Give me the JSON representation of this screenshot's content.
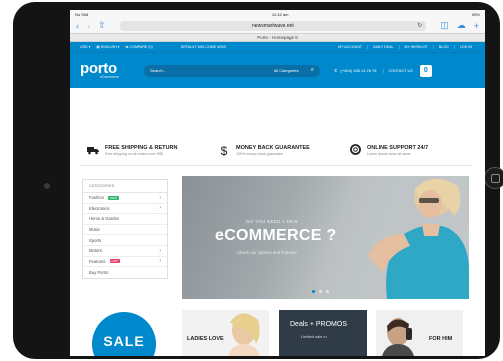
{
  "status_bar": {
    "carrier": "No SIM",
    "time": "12:42 am",
    "battery": "55%"
  },
  "browser": {
    "url": "newsmartwave.net",
    "tab_title": "Porto - Homepage 6"
  },
  "topbar": {
    "currency": "USD",
    "language": "ENGLISH",
    "compare": "COMPARE (0)",
    "welcome": "DEFAULT WELCOME MSG!",
    "links": [
      "MY ACCOUNT",
      "DAILY DEAL",
      "MY WISHLIST",
      "BLOG",
      "LOG IN"
    ]
  },
  "header": {
    "logo": "porto",
    "logo_sub": "eCommerce",
    "search_placeholder": "Search...",
    "search_category": "All Categories",
    "phone": "(+404) 158 14 25 78",
    "contact": "CONTACT US",
    "cart_count": "0"
  },
  "features": [
    {
      "icon": "truck-icon",
      "title": "FREE SHIPPING & RETURN",
      "subtitle": "Free shipping on all orders over 99$."
    },
    {
      "icon": "dollar-icon",
      "title": "MONEY BACK GUARANTEE",
      "subtitle": "100% money back guarantee"
    },
    {
      "icon": "lifebuoy-icon",
      "title": "ONLINE SUPPORT 24/7",
      "subtitle": "Lorem ipsum dolor sit amet."
    }
  ],
  "sidebar": {
    "heading": "CATEGORIES",
    "items": [
      {
        "label": "Fashion",
        "badge": "NEW",
        "badge_color": "#2fb36d",
        "arrow": true
      },
      {
        "label": "Electronics",
        "badge": "",
        "arrow": true
      },
      {
        "label": "Home & Garden",
        "badge": "",
        "arrow": false
      },
      {
        "label": "Music",
        "badge": "",
        "arrow": false
      },
      {
        "label": "Sports",
        "badge": "",
        "arrow": false
      },
      {
        "label": "Motors",
        "badge": "",
        "arrow": true
      },
      {
        "label": "Features",
        "badge": "HOT",
        "badge_color": "#e4406b",
        "arrow": true
      },
      {
        "label": "Buy Porto!",
        "badge": "",
        "arrow": false
      }
    ]
  },
  "banner": {
    "kicker": "DO YOU NEED A NEW",
    "headline": "eCOMMERCE ?",
    "subtitle": "Check our options and features"
  },
  "promos": {
    "sale": "SALE",
    "ladies": "LADIES LOVE",
    "deals": "Deals + PROMOS",
    "deals_sub": "Limited sale in",
    "him": "FOR HIM"
  },
  "colors": {
    "brand": "#0088cc",
    "dark": "#141414"
  }
}
